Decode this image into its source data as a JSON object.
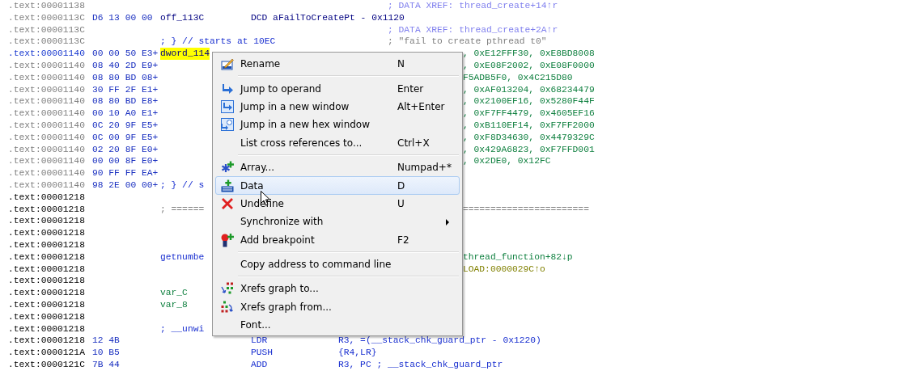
{
  "listing": [
    {
      "addr": ".text:00001138",
      "dimmed": true,
      "current": false,
      "segments": [
        {
          "kind": "xref",
          "text": "; DATA XREF: thread_create+14↑r"
        }
      ]
    },
    {
      "addr": ".text:0000113C",
      "dimmed": true,
      "current": false,
      "segments": [
        {
          "kind": "bytes",
          "text": "D6 13 00 00"
        },
        {
          "kind": "name",
          "text": "off_113C"
        },
        {
          "kind": "directive",
          "text": "DCD aFailToCreatePt - 0x1120"
        }
      ]
    },
    {
      "addr": ".text:0000113C",
      "dimmed": true,
      "current": false,
      "segments": [
        {
          "kind": "xref",
          "text": "; DATA XREF: thread_create+2A↑r"
        }
      ]
    },
    {
      "addr": ".text:0000113C",
      "dimmed": true,
      "current": false,
      "segments": [
        {
          "kind": "marker",
          "text": "; } // starts at 10EC"
        },
        {
          "kind": "remark",
          "text": "; \"fail to create pthread t0\""
        }
      ]
    },
    {
      "addr": ".text:00001140",
      "current": true,
      "segments": [
        {
          "kind": "bytes",
          "text": "00 00 50 E3+"
        },
        {
          "kind": "highlight",
          "text": "dword_114"
        },
        {
          "kind": "data",
          "text": ", 0xE12FFF30, 0xE8BD8008"
        }
      ]
    },
    {
      "addr": ".text:00001140",
      "dimmed": true,
      "current": false,
      "segments": [
        {
          "kind": "bytes",
          "text": "08 40 2D E9+"
        },
        {
          "kind": "data",
          "text": ", 0xE08F2002, 0xE08F0000"
        }
      ]
    },
    {
      "addr": ".text:00001140",
      "dimmed": true,
      "current": false,
      "segments": [
        {
          "kind": "bytes",
          "text": "08 80 BD 08+"
        },
        {
          "kind": "data",
          "text": "F5ADB5F0, 0x4C215D80"
        }
      ]
    },
    {
      "addr": ".text:00001140",
      "dimmed": true,
      "current": false,
      "segments": [
        {
          "kind": "bytes",
          "text": "30 FF 2F E1+"
        },
        {
          "kind": "data",
          "text": ", 0xAF013204, 0x68234479"
        }
      ]
    },
    {
      "addr": ".text:00001140",
      "dimmed": true,
      "current": false,
      "segments": [
        {
          "kind": "bytes",
          "text": "08 80 BD E8+"
        },
        {
          "kind": "data",
          "text": ", 0x2100EF16, 0x5280F44F"
        }
      ]
    },
    {
      "addr": ".text:00001140",
      "dimmed": true,
      "current": false,
      "segments": [
        {
          "kind": "bytes",
          "text": "00 10 A0 E1+"
        },
        {
          "kind": "data",
          "text": ", 0xF7FF4479, 0x4605EF16"
        }
      ]
    },
    {
      "addr": ".text:00001140",
      "dimmed": true,
      "current": false,
      "segments": [
        {
          "kind": "bytes",
          "text": "0C 20 9F E5+"
        },
        {
          "kind": "data",
          "text": ", 0xB110EF14, 0xF7FF2000"
        }
      ]
    },
    {
      "addr": ".text:00001140",
      "dimmed": true,
      "current": false,
      "segments": [
        {
          "kind": "bytes",
          "text": "0C 00 9F E5+"
        },
        {
          "kind": "data",
          "text": ", 0xF8D34630, 0x4479329C"
        }
      ]
    },
    {
      "addr": ".text:00001140",
      "dimmed": true,
      "current": false,
      "segments": [
        {
          "kind": "bytes",
          "text": "02 20 8F E0+"
        },
        {
          "kind": "data",
          "text": ", 0x429A6823, 0xF7FFD001"
        }
      ]
    },
    {
      "addr": ".text:00001140",
      "dimmed": true,
      "current": false,
      "segments": [
        {
          "kind": "bytes",
          "text": "00 00 8F E0+"
        },
        {
          "kind": "data",
          "text": ", 0x2DE0, 0x12FC"
        }
      ]
    },
    {
      "addr": ".text:00001140",
      "dimmed": true,
      "current": false,
      "segments": [
        {
          "kind": "bytes",
          "text": "90 FF FF EA+"
        }
      ]
    },
    {
      "addr": ".text:00001140",
      "dimmed": true,
      "current": false,
      "segments": [
        {
          "kind": "bytes",
          "text": "98 2E 00 00+"
        },
        {
          "kind": "marker",
          "text": "; } // s"
        }
      ]
    },
    {
      "addr": ".text:00001218",
      "dimmed": false,
      "current": false
    },
    {
      "addr": ".text:00001218",
      "dimmed": false,
      "current": false,
      "segments": [
        {
          "kind": "rule",
          "text": "; ======"
        },
        {
          "kind": "rule_tail",
          "text": "======================="
        }
      ]
    },
    {
      "addr": ".text:00001218",
      "dimmed": false,
      "current": false
    },
    {
      "addr": ".text:00001218",
      "dimmed": false,
      "current": false
    },
    {
      "addr": ".text:00001218",
      "dimmed": false,
      "current": false
    },
    {
      "addr": ".text:00001218",
      "dimmed": false,
      "current": false,
      "segments": [
        {
          "kind": "marker",
          "text": "getnumbe"
        },
        {
          "kind": "data",
          "text": "thread_function+82↓p"
        }
      ]
    },
    {
      "addr": ".text:00001218",
      "dimmed": false,
      "current": false,
      "segments": [
        {
          "kind": "load_ref",
          "text": "LOAD:0000029C↑o"
        }
      ]
    },
    {
      "addr": ".text:00001218",
      "dimmed": false,
      "current": false
    },
    {
      "addr": ".text:00001218",
      "dimmed": false,
      "current": false,
      "segments": [
        {
          "kind": "local",
          "text": "var_C"
        }
      ]
    },
    {
      "addr": ".text:00001218",
      "dimmed": false,
      "current": false,
      "segments": [
        {
          "kind": "local",
          "text": "var_8"
        }
      ]
    },
    {
      "addr": ".text:00001218",
      "dimmed": false,
      "current": false
    },
    {
      "addr": ".text:00001218",
      "dimmed": false,
      "current": false,
      "segments": [
        {
          "kind": "marker",
          "text": "; __unwi"
        }
      ]
    },
    {
      "addr": ".text:00001218",
      "dimmed": false,
      "current": false,
      "segments": [
        {
          "kind": "bytes",
          "text": "12 4B"
        },
        {
          "kind": "mnemonic",
          "text": "LDR"
        },
        {
          "kind": "operand",
          "text": "R3, =(__stack_chk_guard_ptr - 0x1220)"
        }
      ]
    },
    {
      "addr": ".text:0000121A",
      "dimmed": false,
      "current": false,
      "segments": [
        {
          "kind": "bytes",
          "text": "10 B5"
        },
        {
          "kind": "mnemonic",
          "text": "PUSH"
        },
        {
          "kind": "operand",
          "text": "{R4,LR}"
        }
      ]
    },
    {
      "addr": ".text:0000121C",
      "dimmed": false,
      "current": false,
      "segments": [
        {
          "kind": "bytes",
          "text": "7B 44"
        },
        {
          "kind": "mnemonic",
          "text": "ADD"
        },
        {
          "kind": "operand",
          "text": "R3, PC ; __stack_chk_guard_ptr"
        }
      ]
    }
  ],
  "context_menu": {
    "items": [
      {
        "kind": "item",
        "label": "Rename",
        "shortcut": "N",
        "selected": false
      },
      {
        "kind": "separator"
      },
      {
        "kind": "item",
        "label": "Jump to operand",
        "shortcut": "Enter",
        "selected": false
      },
      {
        "kind": "item",
        "label": "Jump in a new window",
        "shortcut": "Alt+Enter",
        "selected": false
      },
      {
        "kind": "item",
        "label": "Jump in a new hex window",
        "selected": false
      },
      {
        "kind": "item",
        "label": "List cross references to...",
        "shortcut": "Ctrl+X",
        "selected": false
      },
      {
        "kind": "separator"
      },
      {
        "kind": "item",
        "label": "Array...",
        "shortcut": "Numpad+*",
        "selected": false
      },
      {
        "kind": "item",
        "label": "Data",
        "shortcut": "D",
        "selected": true
      },
      {
        "kind": "item",
        "label": "Undefine",
        "shortcut": "U",
        "selected": false
      },
      {
        "kind": "item",
        "label": "Synchronize with",
        "submenu": true,
        "selected": false
      },
      {
        "kind": "item",
        "label": "Add breakpoint",
        "shortcut": "F2",
        "selected": false
      },
      {
        "kind": "separator"
      },
      {
        "kind": "item",
        "label": "Copy address to command line",
        "selected": false
      },
      {
        "kind": "separator"
      },
      {
        "kind": "item",
        "label": "Xrefs graph to...",
        "selected": false
      },
      {
        "kind": "item",
        "label": "Xrefs graph from...",
        "selected": false
      },
      {
        "kind": "item",
        "label": "Font...",
        "selected": false
      }
    ]
  }
}
